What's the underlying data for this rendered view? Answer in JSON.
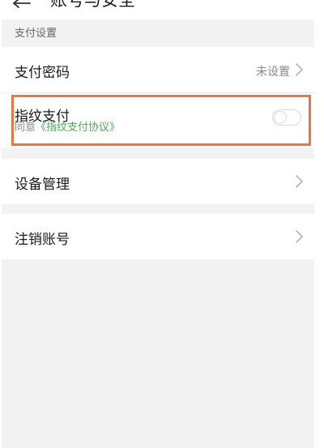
{
  "header": {
    "title": "账号与安全"
  },
  "section": {
    "label": "支付设置"
  },
  "rows": {
    "payment_password": {
      "label": "支付密码",
      "value": "未设置"
    },
    "fingerprint_pay": {
      "label": "指纹支付",
      "agree_prefix": "同意",
      "agreement_link": "《指纹支付协议》",
      "enabled": false
    },
    "device_management": {
      "label": "设备管理"
    },
    "cancel_account": {
      "label": "注销账号"
    }
  },
  "colors": {
    "highlight": "#ee7440",
    "link_green": "#4caa5a",
    "page_bg": "#f2f2f2"
  }
}
